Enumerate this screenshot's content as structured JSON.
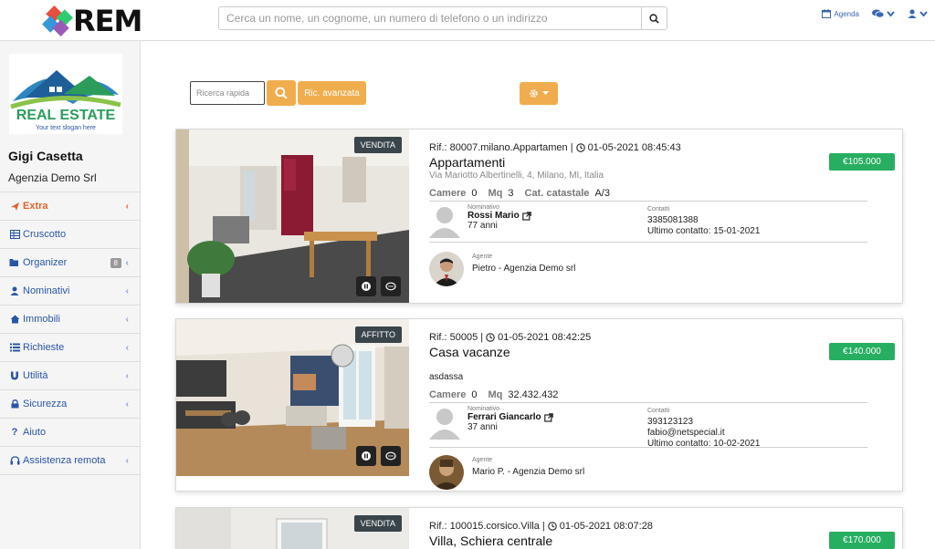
{
  "header": {
    "logo_text": "REM",
    "search_placeholder": "Cerca un nome, un cognome, un numero di telefono o un indirizzo",
    "agenda_label": "Agenda"
  },
  "sidebar": {
    "brand_line1": "REAL ESTATE",
    "brand_line2": "Your text slogan here",
    "user_name": "Gigi Casetta",
    "agency": "Agenzia Demo Srl",
    "items": [
      {
        "label": "Extra"
      },
      {
        "label": "Cruscotto"
      },
      {
        "label": "Organizer",
        "badge": "8"
      },
      {
        "label": "Nominativi"
      },
      {
        "label": "Immobili"
      },
      {
        "label": "Richieste"
      },
      {
        "label": "Utilità"
      },
      {
        "label": "Sicurezza"
      },
      {
        "label": "Aiuto"
      },
      {
        "label": "Assistenza remota"
      }
    ]
  },
  "toolbar": {
    "quick_search_placeholder": "Ricerca rapida",
    "advanced_label": "Ric. avanzata"
  },
  "listings": [
    {
      "tag": "VENDITA",
      "ref": "Rif.: 80007.milano.Appartamen |",
      "datetime": "01-05-2021 08:45:43",
      "title": "Appartamenti",
      "address": "Via Mariotto Albertinelli, 4, Milano, MI, Italia",
      "features": [
        {
          "label": "Camere",
          "value": "0"
        },
        {
          "label": "Mq",
          "value": "3"
        },
        {
          "label": "Cat. catastale",
          "value": "A/3"
        }
      ],
      "lead_label": "Nominativo",
      "lead_name": "Rossi Mario",
      "lead_age": "77 anni",
      "contacts_label": "Contatti",
      "contact_lines": [
        "3385081388",
        "Ultimo contatto: 15-01-2021"
      ],
      "agent_label": "Agente",
      "agent_name": "Pietro - Agenzia Demo srl",
      "price": "€105.000"
    },
    {
      "tag": "AFFITTO",
      "ref": "Rif.: 50005 |",
      "datetime": "01-05-2021 08:42:25",
      "title": "Casa vacanze",
      "description": "asdassa",
      "features": [
        {
          "label": "Camere",
          "value": "0"
        },
        {
          "label": "Mq",
          "value": "32.432.432"
        }
      ],
      "lead_label": "Nominativo",
      "lead_name": "Ferrari Giancarlo",
      "lead_age": "37 anni",
      "contacts_label": "Contatti",
      "contact_lines": [
        "393123123",
        "fabio@netspecial.it",
        "Ultimo contatto: 10-02-2021"
      ],
      "agent_label": "Agente",
      "agent_name": "Mario P. - Agenzia Demo srl",
      "price": "€140.000"
    },
    {
      "tag": "VENDITA",
      "ref": "Rif.: 100015.corsico.Villa |",
      "datetime": "01-05-2021 08:07:28",
      "title": "Villa, Schiera centrale",
      "price": "€170.000"
    }
  ],
  "colors": {
    "accent": "#f0ad4e",
    "link": "#2a55a5",
    "extra": "#e0632a",
    "price": "#27ae60"
  }
}
